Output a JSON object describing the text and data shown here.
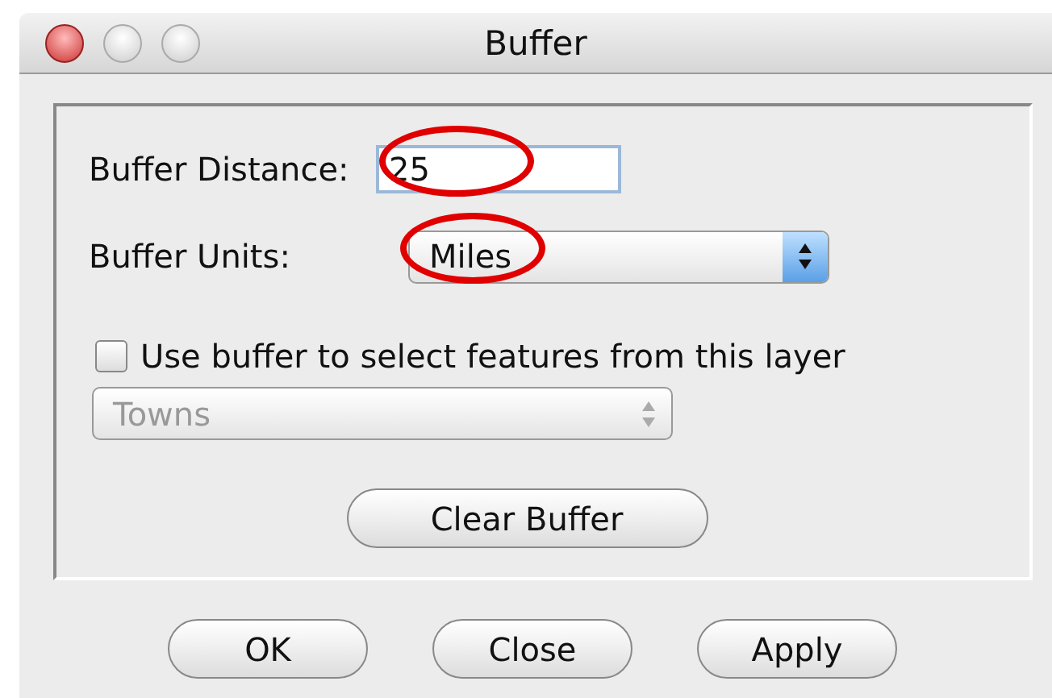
{
  "window": {
    "title": "Buffer"
  },
  "distance": {
    "label": "Buffer Distance:",
    "value": "25",
    "highlighted": true
  },
  "units": {
    "label": "Buffer Units:",
    "value": "Miles",
    "highlighted": true
  },
  "select_features": {
    "label": "Use buffer to select features from this layer",
    "checked": false
  },
  "layer": {
    "value": "Towns",
    "disabled": true
  },
  "clear_button": "Clear Buffer",
  "buttons": [
    "OK",
    "Close",
    "Apply"
  ]
}
